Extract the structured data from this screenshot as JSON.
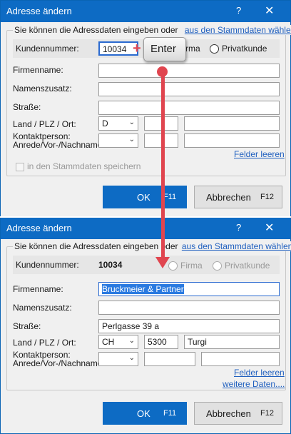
{
  "dialog1": {
    "title": "Adresse ändern",
    "help": "?",
    "close": "✕",
    "legend_text": "Sie können die Adressdaten eingeben oder",
    "legend_link": "aus den Stammdaten wählen...",
    "kundennummer_label": "Kundennummer:",
    "kundennummer_value": "10034",
    "firma_label": "Firma",
    "privatkunde_label": "Privatkunde",
    "firmenname_label": "Firmenname:",
    "namenszusatz_label": "Namenszusatz:",
    "strasse_label": "Straße:",
    "land_label": "Land / PLZ / Ort:",
    "kontakt_label1": "Kontaktperson:",
    "kontakt_label2": "Anrede/Vor-/Nachname",
    "land_value": "D",
    "felder_leeren": "Felder leeren",
    "stammdaten_speichern": "in den Stammdaten speichern",
    "ok_label": "OK",
    "ok_key": "F11",
    "cancel_label": "Abbrechen",
    "cancel_key": "F12"
  },
  "dialog2": {
    "title": "Adresse ändern",
    "help": "?",
    "close": "✕",
    "legend_text": "Sie können die Adressdaten eingeben oder",
    "legend_link": "aus den Stammdaten wählen...",
    "kundennummer_label": "Kundennummer:",
    "kundennummer_value": "10034",
    "firma_label": "Firma",
    "privatkunde_label": "Privatkunde",
    "firmenname_label": "Firmenname:",
    "firmenname_value": "Bruckmeier & Partner",
    "namenszusatz_label": "Namenszusatz:",
    "strasse_label": "Straße:",
    "strasse_value": "Perlgasse 39 a",
    "land_label": "Land / PLZ / Ort:",
    "land_value": "CH",
    "plz_value": "5300",
    "ort_value": "Turgi",
    "kontakt_label1": "Kontaktperson:",
    "kontakt_label2": "Anrede/Vor-/Nachname",
    "felder_leeren": "Felder leeren",
    "weitere_daten": "weitere Daten....",
    "ok_label": "OK",
    "ok_key": "F11",
    "cancel_label": "Abbrechen",
    "cancel_key": "F12"
  },
  "overlay": {
    "key_label": "Enter",
    "plus": "+"
  },
  "colors": {
    "titlebar": "#0d6bc4",
    "arrow": "#e0454f",
    "link": "#1f5fbf"
  }
}
